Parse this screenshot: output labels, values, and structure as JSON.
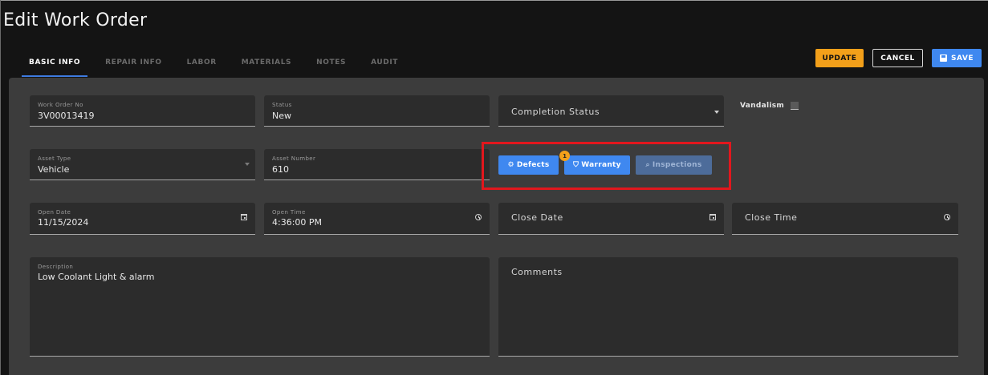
{
  "page": {
    "title": "Edit Work Order"
  },
  "tabs": [
    {
      "label": "BASIC INFO",
      "active": true
    },
    {
      "label": "REPAIR INFO"
    },
    {
      "label": "LABOR"
    },
    {
      "label": "MATERIALS"
    },
    {
      "label": "NOTES"
    },
    {
      "label": "AUDIT"
    }
  ],
  "actions": {
    "update": "UPDATE",
    "cancel": "CANCEL",
    "save": "SAVE"
  },
  "fields": {
    "work_order_no": {
      "label": "Work Order No",
      "value": "3V00013419"
    },
    "status": {
      "label": "Status",
      "value": "New"
    },
    "completion_status": {
      "placeholder": "Completion Status"
    },
    "vandalism": {
      "label": "Vandalism",
      "checked": false
    },
    "asset_type": {
      "label": "Asset Type",
      "value": "Vehicle"
    },
    "asset_number": {
      "label": "Asset Number",
      "value": "610"
    },
    "open_date": {
      "label": "Open Date",
      "value": "11/15/2024"
    },
    "open_time": {
      "label": "Open Time",
      "value": "4:36:00 PM"
    },
    "close_date": {
      "placeholder": "Close Date"
    },
    "close_time": {
      "placeholder": "Close Time"
    },
    "description": {
      "label": "Description",
      "value": "Low Coolant Light & alarm"
    },
    "comments": {
      "placeholder": "Comments"
    }
  },
  "asset_actions": {
    "defects": {
      "label": "Defects",
      "icon": "gear-icon"
    },
    "warranty": {
      "label": "Warranty",
      "icon": "shield-icon",
      "badge": "1"
    },
    "inspections": {
      "label": "Inspections",
      "icon": "search-icon",
      "disabled": true
    }
  },
  "colors": {
    "accent_blue": "#3f88f0",
    "update_orange": "#f3a01a",
    "highlight_red": "#e2171d"
  }
}
